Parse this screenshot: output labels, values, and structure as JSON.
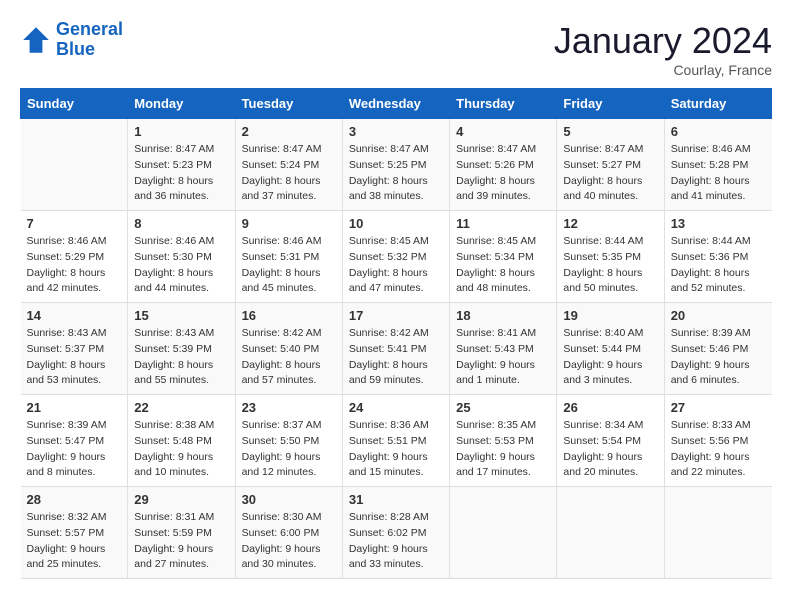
{
  "header": {
    "logo_line1": "General",
    "logo_line2": "Blue",
    "month": "January 2024",
    "location": "Courlay, France"
  },
  "days_of_week": [
    "Sunday",
    "Monday",
    "Tuesday",
    "Wednesday",
    "Thursday",
    "Friday",
    "Saturday"
  ],
  "weeks": [
    [
      {
        "day": "",
        "sunrise": "",
        "sunset": "",
        "daylight": ""
      },
      {
        "day": "1",
        "sunrise": "Sunrise: 8:47 AM",
        "sunset": "Sunset: 5:23 PM",
        "daylight": "Daylight: 8 hours and 36 minutes."
      },
      {
        "day": "2",
        "sunrise": "Sunrise: 8:47 AM",
        "sunset": "Sunset: 5:24 PM",
        "daylight": "Daylight: 8 hours and 37 minutes."
      },
      {
        "day": "3",
        "sunrise": "Sunrise: 8:47 AM",
        "sunset": "Sunset: 5:25 PM",
        "daylight": "Daylight: 8 hours and 38 minutes."
      },
      {
        "day": "4",
        "sunrise": "Sunrise: 8:47 AM",
        "sunset": "Sunset: 5:26 PM",
        "daylight": "Daylight: 8 hours and 39 minutes."
      },
      {
        "day": "5",
        "sunrise": "Sunrise: 8:47 AM",
        "sunset": "Sunset: 5:27 PM",
        "daylight": "Daylight: 8 hours and 40 minutes."
      },
      {
        "day": "6",
        "sunrise": "Sunrise: 8:46 AM",
        "sunset": "Sunset: 5:28 PM",
        "daylight": "Daylight: 8 hours and 41 minutes."
      }
    ],
    [
      {
        "day": "7",
        "sunrise": "Sunrise: 8:46 AM",
        "sunset": "Sunset: 5:29 PM",
        "daylight": "Daylight: 8 hours and 42 minutes."
      },
      {
        "day": "8",
        "sunrise": "Sunrise: 8:46 AM",
        "sunset": "Sunset: 5:30 PM",
        "daylight": "Daylight: 8 hours and 44 minutes."
      },
      {
        "day": "9",
        "sunrise": "Sunrise: 8:46 AM",
        "sunset": "Sunset: 5:31 PM",
        "daylight": "Daylight: 8 hours and 45 minutes."
      },
      {
        "day": "10",
        "sunrise": "Sunrise: 8:45 AM",
        "sunset": "Sunset: 5:32 PM",
        "daylight": "Daylight: 8 hours and 47 minutes."
      },
      {
        "day": "11",
        "sunrise": "Sunrise: 8:45 AM",
        "sunset": "Sunset: 5:34 PM",
        "daylight": "Daylight: 8 hours and 48 minutes."
      },
      {
        "day": "12",
        "sunrise": "Sunrise: 8:44 AM",
        "sunset": "Sunset: 5:35 PM",
        "daylight": "Daylight: 8 hours and 50 minutes."
      },
      {
        "day": "13",
        "sunrise": "Sunrise: 8:44 AM",
        "sunset": "Sunset: 5:36 PM",
        "daylight": "Daylight: 8 hours and 52 minutes."
      }
    ],
    [
      {
        "day": "14",
        "sunrise": "Sunrise: 8:43 AM",
        "sunset": "Sunset: 5:37 PM",
        "daylight": "Daylight: 8 hours and 53 minutes."
      },
      {
        "day": "15",
        "sunrise": "Sunrise: 8:43 AM",
        "sunset": "Sunset: 5:39 PM",
        "daylight": "Daylight: 8 hours and 55 minutes."
      },
      {
        "day": "16",
        "sunrise": "Sunrise: 8:42 AM",
        "sunset": "Sunset: 5:40 PM",
        "daylight": "Daylight: 8 hours and 57 minutes."
      },
      {
        "day": "17",
        "sunrise": "Sunrise: 8:42 AM",
        "sunset": "Sunset: 5:41 PM",
        "daylight": "Daylight: 8 hours and 59 minutes."
      },
      {
        "day": "18",
        "sunrise": "Sunrise: 8:41 AM",
        "sunset": "Sunset: 5:43 PM",
        "daylight": "Daylight: 9 hours and 1 minute."
      },
      {
        "day": "19",
        "sunrise": "Sunrise: 8:40 AM",
        "sunset": "Sunset: 5:44 PM",
        "daylight": "Daylight: 9 hours and 3 minutes."
      },
      {
        "day": "20",
        "sunrise": "Sunrise: 8:39 AM",
        "sunset": "Sunset: 5:46 PM",
        "daylight": "Daylight: 9 hours and 6 minutes."
      }
    ],
    [
      {
        "day": "21",
        "sunrise": "Sunrise: 8:39 AM",
        "sunset": "Sunset: 5:47 PM",
        "daylight": "Daylight: 9 hours and 8 minutes."
      },
      {
        "day": "22",
        "sunrise": "Sunrise: 8:38 AM",
        "sunset": "Sunset: 5:48 PM",
        "daylight": "Daylight: 9 hours and 10 minutes."
      },
      {
        "day": "23",
        "sunrise": "Sunrise: 8:37 AM",
        "sunset": "Sunset: 5:50 PM",
        "daylight": "Daylight: 9 hours and 12 minutes."
      },
      {
        "day": "24",
        "sunrise": "Sunrise: 8:36 AM",
        "sunset": "Sunset: 5:51 PM",
        "daylight": "Daylight: 9 hours and 15 minutes."
      },
      {
        "day": "25",
        "sunrise": "Sunrise: 8:35 AM",
        "sunset": "Sunset: 5:53 PM",
        "daylight": "Daylight: 9 hours and 17 minutes."
      },
      {
        "day": "26",
        "sunrise": "Sunrise: 8:34 AM",
        "sunset": "Sunset: 5:54 PM",
        "daylight": "Daylight: 9 hours and 20 minutes."
      },
      {
        "day": "27",
        "sunrise": "Sunrise: 8:33 AM",
        "sunset": "Sunset: 5:56 PM",
        "daylight": "Daylight: 9 hours and 22 minutes."
      }
    ],
    [
      {
        "day": "28",
        "sunrise": "Sunrise: 8:32 AM",
        "sunset": "Sunset: 5:57 PM",
        "daylight": "Daylight: 9 hours and 25 minutes."
      },
      {
        "day": "29",
        "sunrise": "Sunrise: 8:31 AM",
        "sunset": "Sunset: 5:59 PM",
        "daylight": "Daylight: 9 hours and 27 minutes."
      },
      {
        "day": "30",
        "sunrise": "Sunrise: 8:30 AM",
        "sunset": "Sunset: 6:00 PM",
        "daylight": "Daylight: 9 hours and 30 minutes."
      },
      {
        "day": "31",
        "sunrise": "Sunrise: 8:28 AM",
        "sunset": "Sunset: 6:02 PM",
        "daylight": "Daylight: 9 hours and 33 minutes."
      },
      {
        "day": "",
        "sunrise": "",
        "sunset": "",
        "daylight": ""
      },
      {
        "day": "",
        "sunrise": "",
        "sunset": "",
        "daylight": ""
      },
      {
        "day": "",
        "sunrise": "",
        "sunset": "",
        "daylight": ""
      }
    ]
  ]
}
